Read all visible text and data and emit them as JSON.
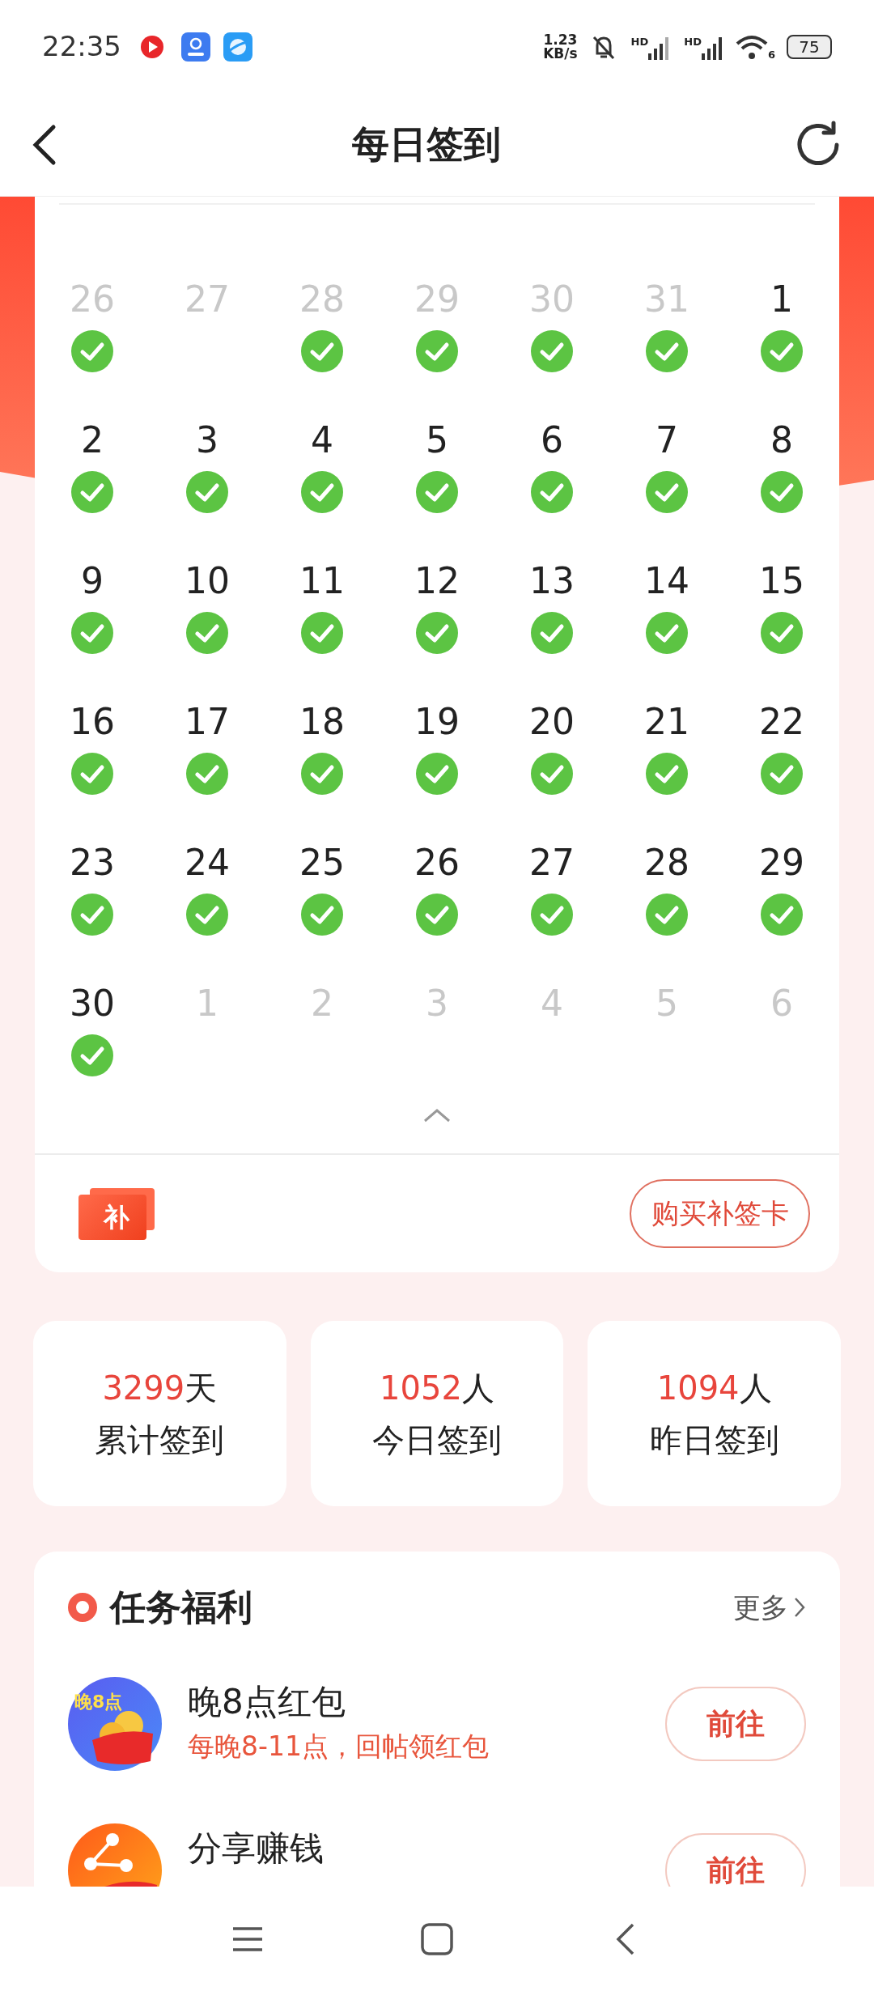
{
  "status_bar": {
    "time": "22:35",
    "net_speed": "1.23",
    "net_unit": "KB/s",
    "signal_1": "HD",
    "signal_2": "HD",
    "wifi": "6",
    "battery": "75"
  },
  "header": {
    "title": "每日签到"
  },
  "calendar": {
    "days": [
      {
        "day": "26",
        "muted": true,
        "checked": true
      },
      {
        "day": "27",
        "muted": true,
        "checked": false
      },
      {
        "day": "28",
        "muted": true,
        "checked": true
      },
      {
        "day": "29",
        "muted": true,
        "checked": true
      },
      {
        "day": "30",
        "muted": true,
        "checked": true
      },
      {
        "day": "31",
        "muted": true,
        "checked": true
      },
      {
        "day": "1",
        "muted": false,
        "checked": true
      },
      {
        "day": "2",
        "muted": false,
        "checked": true
      },
      {
        "day": "3",
        "muted": false,
        "checked": true
      },
      {
        "day": "4",
        "muted": false,
        "checked": true
      },
      {
        "day": "5",
        "muted": false,
        "checked": true
      },
      {
        "day": "6",
        "muted": false,
        "checked": true
      },
      {
        "day": "7",
        "muted": false,
        "checked": true
      },
      {
        "day": "8",
        "muted": false,
        "checked": true
      },
      {
        "day": "9",
        "muted": false,
        "checked": true
      },
      {
        "day": "10",
        "muted": false,
        "checked": true
      },
      {
        "day": "11",
        "muted": false,
        "checked": true
      },
      {
        "day": "12",
        "muted": false,
        "checked": true
      },
      {
        "day": "13",
        "muted": false,
        "checked": true
      },
      {
        "day": "14",
        "muted": false,
        "checked": true
      },
      {
        "day": "15",
        "muted": false,
        "checked": true
      },
      {
        "day": "16",
        "muted": false,
        "checked": true
      },
      {
        "day": "17",
        "muted": false,
        "checked": true
      },
      {
        "day": "18",
        "muted": false,
        "checked": true
      },
      {
        "day": "19",
        "muted": false,
        "checked": true
      },
      {
        "day": "20",
        "muted": false,
        "checked": true
      },
      {
        "day": "21",
        "muted": false,
        "checked": true
      },
      {
        "day": "22",
        "muted": false,
        "checked": true
      },
      {
        "day": "23",
        "muted": false,
        "checked": true
      },
      {
        "day": "24",
        "muted": false,
        "checked": true
      },
      {
        "day": "25",
        "muted": false,
        "checked": true
      },
      {
        "day": "26",
        "muted": false,
        "checked": true
      },
      {
        "day": "27",
        "muted": false,
        "checked": true
      },
      {
        "day": "28",
        "muted": false,
        "checked": true
      },
      {
        "day": "29",
        "muted": false,
        "checked": true
      },
      {
        "day": "30",
        "muted": false,
        "checked": true
      },
      {
        "day": "1",
        "muted": true,
        "checked": false
      },
      {
        "day": "2",
        "muted": true,
        "checked": false
      },
      {
        "day": "3",
        "muted": true,
        "checked": false
      },
      {
        "day": "4",
        "muted": true,
        "checked": false
      },
      {
        "day": "5",
        "muted": true,
        "checked": false
      },
      {
        "day": "6",
        "muted": true,
        "checked": false
      }
    ],
    "card_label": "补",
    "buy_button": "购买补签卡"
  },
  "stats": [
    {
      "value": "3299",
      "unit": "天",
      "label": "累计签到"
    },
    {
      "value": "1052",
      "unit": "人",
      "label": "今日签到"
    },
    {
      "value": "1094",
      "unit": "人",
      "label": "昨日签到"
    }
  ],
  "tasks": {
    "title": "任务福利",
    "more": "更多",
    "items": [
      {
        "kind": "envelope",
        "icon_text": "晚8点",
        "title": "晚8点红包",
        "subtitle": "每晚8-11点，回帖领红包",
        "button": "前往"
      },
      {
        "kind": "share",
        "title": "分享赚钱",
        "button": "前往"
      }
    ]
  }
}
